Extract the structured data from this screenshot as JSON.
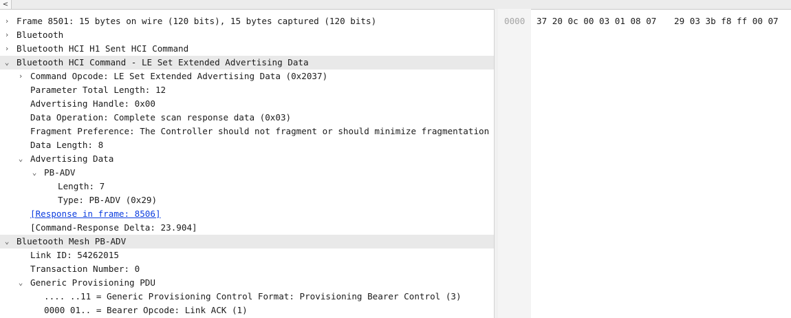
{
  "tree": [
    {
      "text": "Frame 8501: 15 bytes on wire (120 bits), 15 bytes captured (120 bits)",
      "toggle": "collapsed",
      "level": 0
    },
    {
      "text": "Bluetooth",
      "toggle": "collapsed",
      "level": 0
    },
    {
      "text": "Bluetooth HCI H1 Sent HCI Command",
      "toggle": "collapsed",
      "level": 0
    },
    {
      "text": "Bluetooth HCI Command - LE Set Extended Advertising Data",
      "toggle": "expanded",
      "level": 0,
      "highlight": true
    },
    {
      "text": "Command Opcode: LE Set Extended Advertising Data (0x2037)",
      "toggle": "collapsed",
      "level": 1
    },
    {
      "text": "Parameter Total Length: 12",
      "level": 1
    },
    {
      "text": "Advertising Handle: 0x00",
      "level": 1
    },
    {
      "text": "Data Operation: Complete scan response data (0x03)",
      "level": 1
    },
    {
      "text": "Fragment Preference: The Controller should not fragment or should minimize fragmentation",
      "level": 1
    },
    {
      "text": "Data Length: 8",
      "level": 1
    },
    {
      "text": "Advertising Data",
      "toggle": "expanded",
      "level": 1
    },
    {
      "text": "PB-ADV",
      "toggle": "expanded",
      "level": 2
    },
    {
      "text": "Length: 7",
      "level": 3
    },
    {
      "text": "Type: PB-ADV (0x29)",
      "level": 3
    },
    {
      "text": "[Response in frame: 8506]",
      "level": 1,
      "link": true
    },
    {
      "text": "[Command-Response Delta: 23.904]",
      "level": 1
    },
    {
      "text": "Bluetooth Mesh PB-ADV",
      "toggle": "expanded",
      "level": 0,
      "highlight": true
    },
    {
      "text": "Link ID: 54262015",
      "level": 1
    },
    {
      "text": "Transaction Number: 0",
      "level": 1
    },
    {
      "text": "Generic Provisioning PDU",
      "toggle": "expanded",
      "level": 1
    },
    {
      "text": ".... ..11 = Generic Provisioning Control Format: Provisioning Bearer Control (3)",
      "level": 2
    },
    {
      "text": "0000 01.. = Bearer Opcode: Link ACK (1)",
      "level": 2
    }
  ],
  "hex": {
    "offset": "0000",
    "bytes_a": "37 20 0c 00 03 01 08 07",
    "bytes_b": "29 03 3b f8 ff 00 07"
  },
  "icons": {
    "collapsed": "›",
    "expanded": "⌄",
    "scroll_left": "<"
  },
  "colors": {
    "highlight_row": "#e9e9e9",
    "link": "#0a3cdf",
    "offset_text": "#a4a4a4"
  }
}
